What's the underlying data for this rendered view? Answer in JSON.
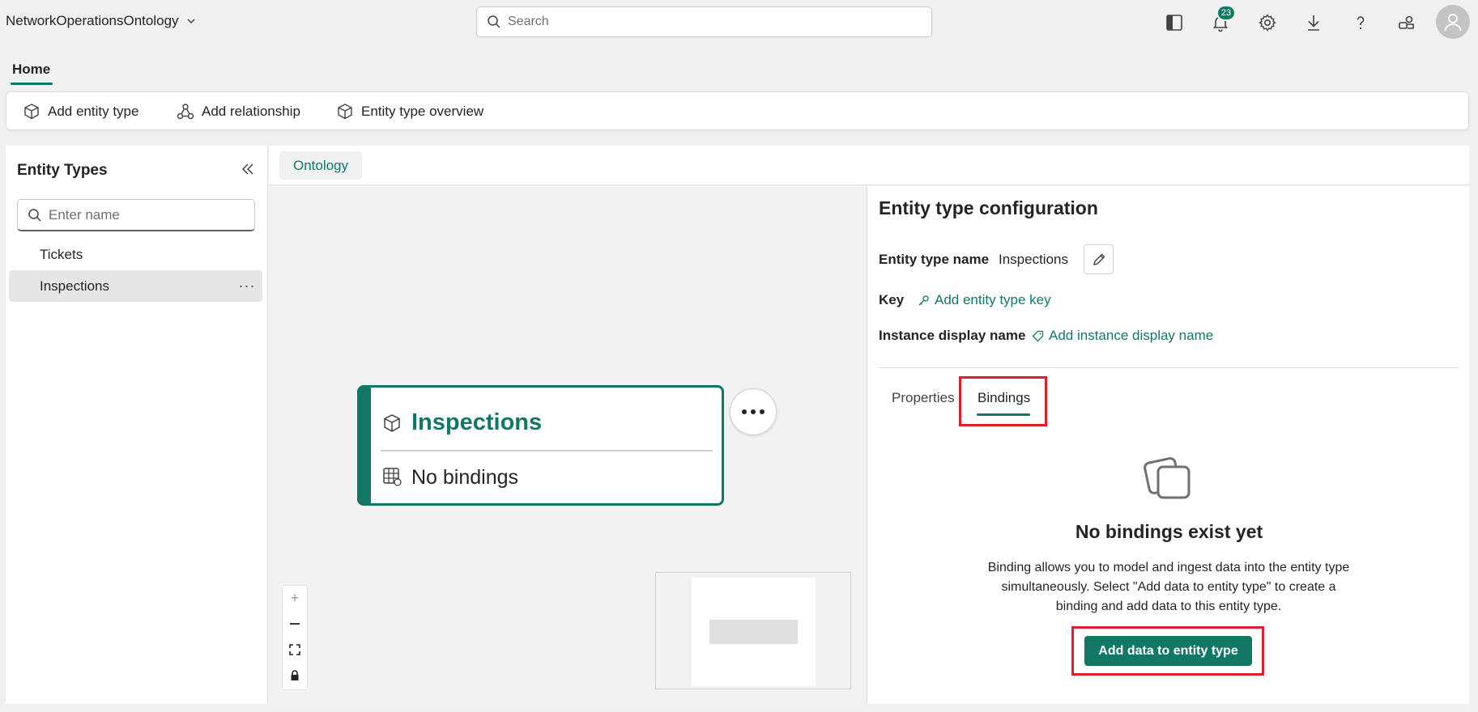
{
  "app": {
    "title": "NetworkOperationsOntology",
    "search_placeholder": "Search",
    "notification_count": "23"
  },
  "tabs": {
    "home_label": "Home"
  },
  "ribbon": {
    "add_entity_type": "Add entity type",
    "add_relationship": "Add relationship",
    "entity_type_overview": "Entity type overview"
  },
  "sidebar": {
    "title": "Entity Types",
    "search_placeholder": "Enter name",
    "items": [
      {
        "label": "Tickets"
      },
      {
        "label": "Inspections"
      }
    ],
    "more_label": "···"
  },
  "main": {
    "tab_label": "Ontology"
  },
  "canvas": {
    "node": {
      "title": "Inspections",
      "bindings_label": "No bindings"
    },
    "zoom": {
      "plus": "+",
      "minus": "—"
    }
  },
  "config": {
    "title": "Entity type configuration",
    "name_label": "Entity type name",
    "name_value": "Inspections",
    "key_label": "Key",
    "key_link": "Add entity type key",
    "display_label": "Instance display name",
    "display_link": "Add instance display name",
    "tabs": [
      {
        "label": "Properties"
      },
      {
        "label": "Bindings"
      }
    ],
    "empty": {
      "title": "No bindings exist yet",
      "description": "Binding allows you to model and ingest data into the entity type simultaneously. Select \"Add data to entity type\" to create a binding and add data to this entity type.",
      "button": "Add data to entity type"
    }
  },
  "colors": {
    "accent": "#117865",
    "highlight": "#e01f26"
  },
  "icons": {
    "app_chevron": "chevron-down-icon",
    "search": "search-icon",
    "panel": "panel-icon",
    "bell": "bell-icon",
    "gear": "gear-icon",
    "download": "download-icon",
    "help": "help-icon",
    "share": "share-icon",
    "user": "user-icon",
    "cube": "cube-icon",
    "relationship": "relationship-icon",
    "collapse": "double-chevron-left-icon",
    "table": "table-icon",
    "ellipsis": "ellipsis-icon",
    "pencil": "pencil-icon",
    "key": "key-icon",
    "tag": "tag-icon",
    "stacked_squares": "stacked-squares-icon"
  }
}
